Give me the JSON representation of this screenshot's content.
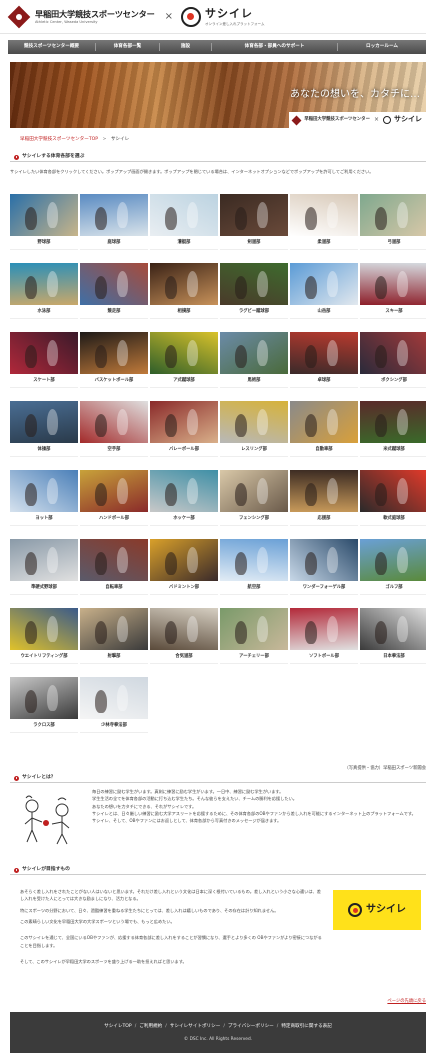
{
  "header": {
    "site_title_jp": "早稲田大学競技スポーツセンター",
    "site_title_en": "Athletic Center, Waseda University",
    "times": "×",
    "sasile_name": "サシイレ",
    "sasile_tagline": "オンライン差し入れプラットフォーム"
  },
  "nav": {
    "items": [
      {
        "label": "競技スポーツセンター概要"
      },
      {
        "label": "体育各部一覧"
      },
      {
        "label": "施設"
      },
      {
        "label": "体育各部・部員へのサポート"
      },
      {
        "label": "ロッカールーム"
      }
    ]
  },
  "hero": {
    "tagline": "あなたの想いを、カタチに…",
    "brand_jp": "早稲田大学競技スポーツセンター",
    "brand_x": "×",
    "brand_sasile": "サシイレ"
  },
  "breadcrumb": {
    "home": "早稲田大学競技スポーツセンターTOP",
    "sep": ">",
    "current": "サシイレ"
  },
  "clubs_section": {
    "heading": "サシイレする体育各部を選ぶ",
    "intro": "サシイレしたい体育各部をクリックしてください。ポップアップ画面が開きます。ポップアップを閉じている場合は、インターネットオプションなどでポップアップを許可してご利用ください。",
    "clubs": [
      {
        "name": "野球部",
        "bg": [
          "#2a6fa8",
          "#c8b58a"
        ]
      },
      {
        "name": "庭球部",
        "bg": [
          "#5a8bc2",
          "#d9e3ea"
        ]
      },
      {
        "name": "漕艇部",
        "bg": [
          "#bcd3e1",
          "#e9eef2"
        ]
      },
      {
        "name": "剣道部",
        "bg": [
          "#3a2a22",
          "#6a4a3a"
        ]
      },
      {
        "name": "柔道部",
        "bg": [
          "#d8c9b8",
          "#ffffff"
        ]
      },
      {
        "name": "弓道部",
        "bg": [
          "#7fa88e",
          "#d8c8a8"
        ]
      },
      {
        "name": "水泳部",
        "bg": [
          "#2b8fb8",
          "#c9a86a"
        ]
      },
      {
        "name": "競走部",
        "bg": [
          "#a74b3b",
          "#3f6fa6"
        ]
      },
      {
        "name": "相撲部",
        "bg": [
          "#3a2216",
          "#c8925a"
        ]
      },
      {
        "name": "ラグビー蹴球部",
        "bg": [
          "#3e6b2e",
          "#4a3a2a"
        ]
      },
      {
        "name": "山岳部",
        "bg": [
          "#5b9bd6",
          "#e2e8ee"
        ]
      },
      {
        "name": "スキー部",
        "bg": [
          "#d6dbe0",
          "#8d1f2a"
        ]
      },
      {
        "name": "スケート部",
        "bg": [
          "#3a1a2a",
          "#b0283a"
        ]
      },
      {
        "name": "バスケットボール部",
        "bg": [
          "#1e1a18",
          "#c07a3a"
        ]
      },
      {
        "name": "ア式蹴球部",
        "bg": [
          "#d9c22a",
          "#2e5e2a"
        ]
      },
      {
        "name": "馬術部",
        "bg": [
          "#6b8ba8",
          "#4a6a3a"
        ]
      },
      {
        "name": "卓球部",
        "bg": [
          "#b93a2e",
          "#3a2a2a"
        ]
      },
      {
        "name": "ボクシング部",
        "bg": [
          "#a43a3a",
          "#2a2a3a"
        ]
      },
      {
        "name": "体操部",
        "bg": [
          "#4a6e94",
          "#2a3a4a"
        ]
      },
      {
        "name": "空手部",
        "bg": [
          "#e0e0e0",
          "#a32a2a"
        ]
      },
      {
        "name": "バレーボール部",
        "bg": [
          "#8a2a2a",
          "#d9b08a"
        ]
      },
      {
        "name": "レスリング部",
        "bg": [
          "#d6b23a",
          "#b8b8b8"
        ]
      },
      {
        "name": "自動車部",
        "bg": [
          "#8a8a8a",
          "#d9a03a"
        ]
      },
      {
        "name": "米式蹴球部",
        "bg": [
          "#5a2a2a",
          "#3a6a2a"
        ]
      },
      {
        "name": "ヨット部",
        "bg": [
          "#4a7fb8",
          "#d6e2ee"
        ]
      },
      {
        "name": "ハンドボール部",
        "bg": [
          "#c8a23a",
          "#8a2a2a"
        ]
      },
      {
        "name": "ホッケー部",
        "bg": [
          "#3e8fa6",
          "#c8c8c8"
        ]
      },
      {
        "name": "フェンシング部",
        "bg": [
          "#d9c8a8",
          "#6a5a4a"
        ]
      },
      {
        "name": "応援部",
        "bg": [
          "#3a2a22",
          "#c89a5a"
        ]
      },
      {
        "name": "軟式庭球部",
        "bg": [
          "#e33a2a",
          "#2a2a2a"
        ]
      },
      {
        "name": "準硬式野球部",
        "bg": [
          "#8a9aa8",
          "#e0e0e0"
        ]
      },
      {
        "name": "自転車部",
        "bg": [
          "#8a3a2a",
          "#5a5a6a"
        ]
      },
      {
        "name": "バドミントン部",
        "bg": [
          "#d9a02a",
          "#3a2a2a"
        ]
      },
      {
        "name": "航空部",
        "bg": [
          "#6aa0d6",
          "#e2ecf5"
        ]
      },
      {
        "name": "ワンダーフォーゲル部",
        "bg": [
          "#2a4a6a",
          "#c8d8e8"
        ]
      },
      {
        "name": "ゴルフ部",
        "bg": [
          "#6aa0d6",
          "#5a8a3a"
        ]
      },
      {
        "name": "ウエイトリフティング部",
        "bg": [
          "#3a5a8a",
          "#e0c22a"
        ]
      },
      {
        "name": "射撃部",
        "bg": [
          "#c8b08a",
          "#3a3a3a"
        ]
      },
      {
        "name": "合気道部",
        "bg": [
          "#d6cfc2",
          "#5a4a3a"
        ]
      },
      {
        "name": "アーチェリー部",
        "bg": [
          "#7a9a6a",
          "#c8b89a"
        ]
      },
      {
        "name": "ソフトボール部",
        "bg": [
          "#b32a3a",
          "#e0e0e0"
        ]
      },
      {
        "name": "日本拳法部",
        "bg": [
          "#e0e0e0",
          "#3a3a3a"
        ]
      },
      {
        "name": "ラクロス部",
        "bg": [
          "#c8c8c8",
          "#3a3a3a"
        ]
      },
      {
        "name": "少林寺拳法部",
        "bg": [
          "#d0d8e0",
          "#f5f5f5"
        ]
      }
    ],
    "credit": "（写真提供・協力）早稲田スポーツ新聞会"
  },
  "about": {
    "heading": "サシイレとは？",
    "lines": [
      "毎日の練習に励む学生がいます。真剣に練習に励む学生がいます。一日中、練習に励む学生がいます。",
      "学生生活の全てを体育各部の活動に打ち込む学生たち。そんな彼らを支えたい、チームの勝利を応援したい。",
      "あなたの想いを力タチにできる、それがサシイレです。",
      "サシイレとは、日々厳しい練習に励む大学アスリートを応援するために、その体育各部のOBやファンから差し入れを可能にするインターネット上のプラットフォームです。",
      "サシイレ、そして、OBやファンにはお返しとして、体育各部から写真付きのメッセージが届きます。"
    ]
  },
  "aim": {
    "heading": "サシイレが目指すもの",
    "paragraphs": [
      "あそらく差し入れをされたことがない人はいないと思います。それだけ差し入れという文化は日本に深く根付いているもの。差し入れという小さな心遣いは、差し入れを受けた人にとっては大きな励ましになり、活力となる。",
      "特にスポーツの分野において、日々、過酷練習を重ねる学生たちにとっては、差し入れは嬉しいものであり、その存在は計り知れません。",
      "この素晴らしい文化を早稲田大学の大学スポーツという場でも、もっと広めたい。",
      "このサシイレを通じて、全国にいるOBやファンが、応援する体育各部に差し入れをすることが習慣になり、選手とより多くの OBやファンがより密接につながることを目指します。",
      "そして、このサシイレが早稲田大学のスポーツを盛り上げる一助を担えればと思います。"
    ],
    "card_text": "サシイレ"
  },
  "pagetop": "ページの先頭に戻る",
  "footer": {
    "links": [
      {
        "label": "サシイレTOP"
      },
      {
        "label": "ご利用規約"
      },
      {
        "label": "サシイレサイトポリシー"
      },
      {
        "label": "プライバシーポリシー"
      },
      {
        "label": "特定商取引に関する表記"
      }
    ],
    "sep": "/",
    "copyright": "© DSC Inc. All Rights Reserved."
  },
  "colors": {
    "brand_red": "#8b1a1a",
    "link_red": "#c02020",
    "nav_dark": "#4a4a4a",
    "footer_bg": "#3b3b3b",
    "card_yellow": "#ffe11a"
  }
}
